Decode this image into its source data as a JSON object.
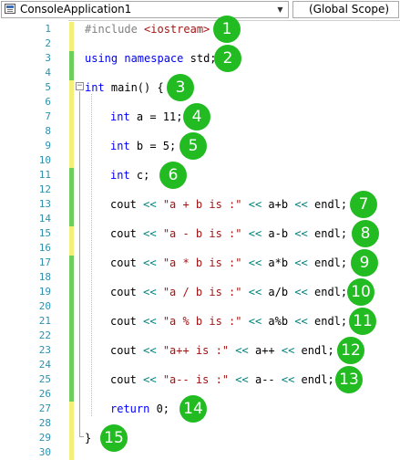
{
  "toolbar": {
    "project": "ConsoleApplication1",
    "scope": "(Global Scope)",
    "project_icon": "console-project-icon",
    "dropdown_icon": "chevron-down-icon"
  },
  "colors": {
    "keyword": "#0000ff",
    "preprocessor": "#808080",
    "string": "#a31515",
    "operator": "#008080",
    "line_number": "#2b91af",
    "saved_change": "#6fcf5e",
    "unsaved_change": "#f4ee7a",
    "badge": "#22bb22"
  },
  "line_numbers": [
    "1",
    "2",
    "3",
    "4",
    "5",
    "6",
    "7",
    "8",
    "9",
    "10",
    "11",
    "12",
    "13",
    "14",
    "15",
    "16",
    "17",
    "18",
    "19",
    "20",
    "21",
    "22",
    "23",
    "24",
    "25",
    "26",
    "27",
    "28",
    "29",
    "30"
  ],
  "code": [
    {
      "line": 1,
      "tokens": [
        {
          "c": "pp",
          "t": "#include "
        },
        {
          "c": "str",
          "t": "<iostream>"
        }
      ]
    },
    {
      "line": 3,
      "tokens": [
        {
          "c": "kw",
          "t": "using"
        },
        {
          "c": "plain",
          "t": " "
        },
        {
          "c": "kw",
          "t": "namespace"
        },
        {
          "c": "plain",
          "t": " std;"
        }
      ]
    },
    {
      "line": 5,
      "tokens": [
        {
          "c": "kw",
          "t": "int"
        },
        {
          "c": "plain",
          "t": " main() {"
        }
      ]
    },
    {
      "line": 7,
      "tokens": [
        {
          "c": "kw",
          "t": "int"
        },
        {
          "c": "plain",
          "t": " a = 11;"
        }
      ]
    },
    {
      "line": 9,
      "tokens": [
        {
          "c": "kw",
          "t": "int"
        },
        {
          "c": "plain",
          "t": " b = 5;"
        }
      ]
    },
    {
      "line": 11,
      "tokens": [
        {
          "c": "kw",
          "t": "int"
        },
        {
          "c": "plain",
          "t": " c;"
        }
      ]
    },
    {
      "line": 13,
      "tokens": [
        {
          "c": "plain",
          "t": "cout "
        },
        {
          "c": "op",
          "t": "<<"
        },
        {
          "c": "plain",
          "t": " "
        },
        {
          "c": "str",
          "t": "\"a + b is :\""
        },
        {
          "c": "plain",
          "t": " "
        },
        {
          "c": "op",
          "t": "<<"
        },
        {
          "c": "plain",
          "t": " a+b "
        },
        {
          "c": "op",
          "t": "<<"
        },
        {
          "c": "plain",
          "t": " endl;"
        }
      ]
    },
    {
      "line": 15,
      "tokens": [
        {
          "c": "plain",
          "t": "cout "
        },
        {
          "c": "op",
          "t": "<<"
        },
        {
          "c": "plain",
          "t": " "
        },
        {
          "c": "str",
          "t": "\"a - b is :\""
        },
        {
          "c": "plain",
          "t": " "
        },
        {
          "c": "op",
          "t": "<<"
        },
        {
          "c": "plain",
          "t": " a-b "
        },
        {
          "c": "op",
          "t": "<<"
        },
        {
          "c": "plain",
          "t": " endl;"
        }
      ]
    },
    {
      "line": 17,
      "tokens": [
        {
          "c": "plain",
          "t": "cout "
        },
        {
          "c": "op",
          "t": "<<"
        },
        {
          "c": "plain",
          "t": " "
        },
        {
          "c": "str",
          "t": "\"a * b is :\""
        },
        {
          "c": "plain",
          "t": " "
        },
        {
          "c": "op",
          "t": "<<"
        },
        {
          "c": "plain",
          "t": " a*b "
        },
        {
          "c": "op",
          "t": "<<"
        },
        {
          "c": "plain",
          "t": " endl;"
        }
      ]
    },
    {
      "line": 19,
      "tokens": [
        {
          "c": "plain",
          "t": "cout "
        },
        {
          "c": "op",
          "t": "<<"
        },
        {
          "c": "plain",
          "t": " "
        },
        {
          "c": "str",
          "t": "\"a / b is :\""
        },
        {
          "c": "plain",
          "t": " "
        },
        {
          "c": "op",
          "t": "<<"
        },
        {
          "c": "plain",
          "t": " a/b "
        },
        {
          "c": "op",
          "t": "<<"
        },
        {
          "c": "plain",
          "t": " endl;"
        }
      ]
    },
    {
      "line": 21,
      "tokens": [
        {
          "c": "plain",
          "t": "cout "
        },
        {
          "c": "op",
          "t": "<<"
        },
        {
          "c": "plain",
          "t": " "
        },
        {
          "c": "str",
          "t": "\"a % b is :\""
        },
        {
          "c": "plain",
          "t": " "
        },
        {
          "c": "op",
          "t": "<<"
        },
        {
          "c": "plain",
          "t": " a%b "
        },
        {
          "c": "op",
          "t": "<<"
        },
        {
          "c": "plain",
          "t": " endl;"
        }
      ]
    },
    {
      "line": 23,
      "tokens": [
        {
          "c": "plain",
          "t": "cout "
        },
        {
          "c": "op",
          "t": "<<"
        },
        {
          "c": "plain",
          "t": " "
        },
        {
          "c": "str",
          "t": "\"a++ is :\""
        },
        {
          "c": "plain",
          "t": " "
        },
        {
          "c": "op",
          "t": "<<"
        },
        {
          "c": "plain",
          "t": " a++ "
        },
        {
          "c": "op",
          "t": "<<"
        },
        {
          "c": "plain",
          "t": " endl;"
        }
      ]
    },
    {
      "line": 25,
      "tokens": [
        {
          "c": "plain",
          "t": "cout "
        },
        {
          "c": "op",
          "t": "<<"
        },
        {
          "c": "plain",
          "t": " "
        },
        {
          "c": "str",
          "t": "\"a-- is :\""
        },
        {
          "c": "plain",
          "t": " "
        },
        {
          "c": "op",
          "t": "<<"
        },
        {
          "c": "plain",
          "t": " a-- "
        },
        {
          "c": "op",
          "t": "<<"
        },
        {
          "c": "plain",
          "t": " endl;"
        }
      ]
    },
    {
      "line": 27,
      "tokens": [
        {
          "c": "kw",
          "t": "return"
        },
        {
          "c": "plain",
          "t": " 0;"
        }
      ]
    },
    {
      "line": 29,
      "tokens": [
        {
          "c": "plain",
          "t": "}"
        }
      ]
    }
  ],
  "change_markers": [
    {
      "from": 1,
      "to": 2,
      "kind": "unsaved"
    },
    {
      "from": 3,
      "to": 4,
      "kind": "saved"
    },
    {
      "from": 5,
      "to": 10,
      "kind": "unsaved"
    },
    {
      "from": 11,
      "to": 14,
      "kind": "saved"
    },
    {
      "from": 15,
      "to": 16,
      "kind": "unsaved"
    },
    {
      "from": 17,
      "to": 26,
      "kind": "saved"
    },
    {
      "from": 27,
      "to": 30,
      "kind": "unsaved"
    }
  ],
  "fold_toggle": "−",
  "badges": [
    {
      "label": "1",
      "line": 1
    },
    {
      "label": "2",
      "line": 3
    },
    {
      "label": "3",
      "line": 5
    },
    {
      "label": "4",
      "line": 7
    },
    {
      "label": "5",
      "line": 9
    },
    {
      "label": "6",
      "line": 11
    },
    {
      "label": "7",
      "line": 13
    },
    {
      "label": "8",
      "line": 15
    },
    {
      "label": "9",
      "line": 17
    },
    {
      "label": "10",
      "line": 19
    },
    {
      "label": "11",
      "line": 21
    },
    {
      "label": "12",
      "line": 23
    },
    {
      "label": "13",
      "line": 25
    },
    {
      "label": "14",
      "line": 27
    },
    {
      "label": "15",
      "line": 29
    }
  ]
}
